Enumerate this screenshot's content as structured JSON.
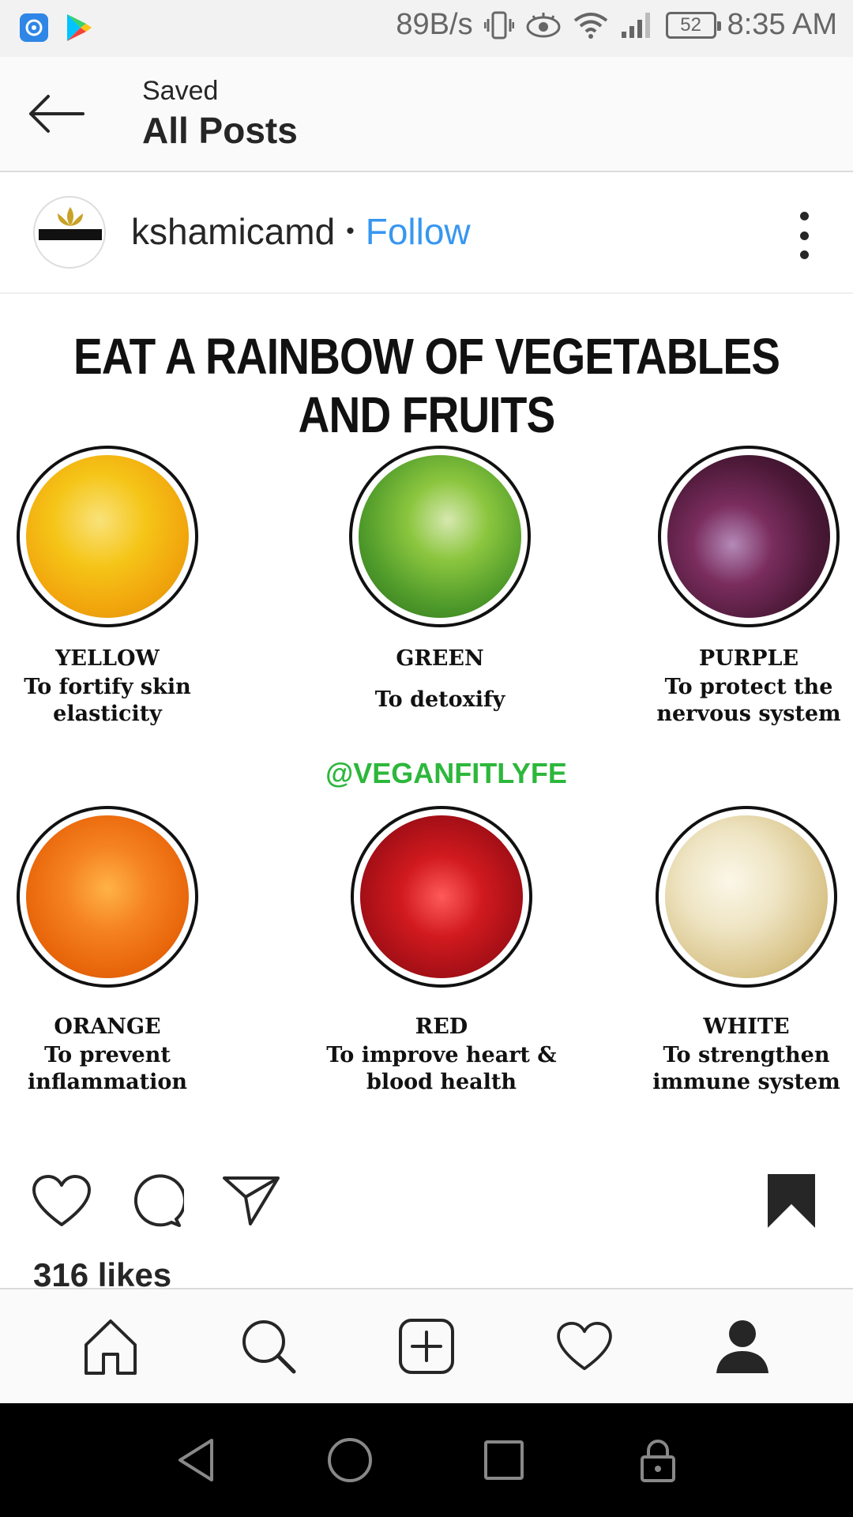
{
  "status_bar": {
    "net_speed": "89B/s",
    "battery": "52",
    "time": "8:35 AM"
  },
  "header": {
    "subtitle": "Saved",
    "title": "All Posts"
  },
  "post": {
    "username": "kshamicamd",
    "separator": "•",
    "follow_label": "Follow",
    "image": {
      "headline": "EAT A RAINBOW OF VEGETABLES AND FRUITS",
      "handle": "@VEGANFITLYFE",
      "items": [
        {
          "color": "YELLOW",
          "desc": "To fortify skin elasticity",
          "tint": "#f2c01a"
        },
        {
          "color": "GREEN",
          "desc": "To detoxify",
          "tint": "#5aa631"
        },
        {
          "color": "PURPLE",
          "desc": "To protect the nervous system",
          "tint": "#5b1f45"
        },
        {
          "color": "ORANGE",
          "desc": "To prevent inflammation",
          "tint": "#f07a12"
        },
        {
          "color": "RED",
          "desc": "To improve heart & blood health",
          "tint": "#c8161c"
        },
        {
          "color": "WHITE",
          "desc": "To strengthen immune system",
          "tint": "#e9dcb8"
        }
      ]
    },
    "likes": "316 likes"
  },
  "icons": {
    "back": "arrow-left-icon",
    "more": "more-vertical-icon",
    "like": "heart-icon",
    "comment": "comment-icon",
    "share": "paper-plane-icon",
    "save": "bookmark-icon"
  },
  "bottom_nav": [
    "home",
    "search",
    "add-post",
    "activity",
    "profile"
  ],
  "colors": {
    "follow": "#3897f0",
    "handle": "#2db73c"
  }
}
